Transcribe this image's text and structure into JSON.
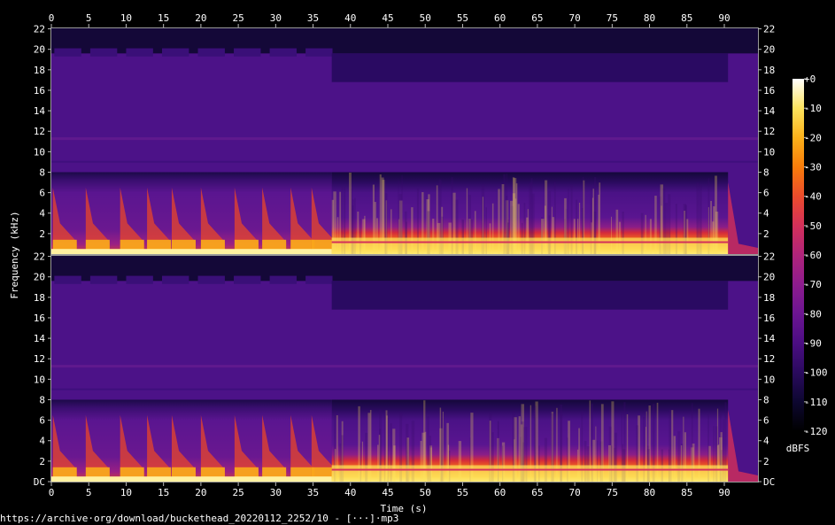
{
  "chart_data": {
    "type": "heatmap",
    "title": "",
    "xlabel": "Time (s)",
    "ylabel": "Frequency (kHz)",
    "x_ticks": [
      "0",
      "5",
      "10",
      "15",
      "20",
      "25",
      "30",
      "35",
      "40",
      "45",
      "50",
      "55",
      "60",
      "65",
      "70",
      "75",
      "80",
      "85",
      "90"
    ],
    "xlim": [
      0,
      94.5
    ],
    "channels": [
      {
        "y_ticks": [
          "22",
          "20",
          "18",
          "16",
          "14",
          "12",
          "10",
          "8",
          "6",
          "4",
          "2"
        ]
      },
      {
        "y_ticks": [
          "22",
          "20",
          "18",
          "16",
          "14",
          "12",
          "10",
          "8",
          "6",
          "4",
          "2",
          "DC"
        ]
      }
    ],
    "ylim_khz": [
      0,
      22.05
    ],
    "colorbar": {
      "label": "dBFS",
      "ticks": [
        "+0",
        "-10",
        "-20",
        "-30",
        "-40",
        "-50",
        "-60",
        "-70",
        "-80",
        "-90",
        "-100",
        "-110",
        "-120"
      ],
      "range": [
        -120,
        0
      ],
      "colors": [
        "#000000",
        "#0d0730",
        "#2a0a5e",
        "#4b0d83",
        "#6c1592",
        "#8e1c8e",
        "#b0247a",
        "#d3305a",
        "#ec4c2c",
        "#f87c0a",
        "#fbb11a",
        "#fde45e",
        "#ffffff"
      ]
    },
    "segments": [
      {
        "t_start": 0,
        "t_end": 37.5,
        "description_level": "sparse notes"
      },
      {
        "t_start": 37.5,
        "t_end": 90.5,
        "description_level": "dense"
      },
      {
        "t_start": 90.5,
        "t_end": 94.5,
        "description_level": "decay"
      }
    ]
  },
  "caption": "https://archive·org/download/buckethead_20220112_2252/10 - [···]·mp3"
}
